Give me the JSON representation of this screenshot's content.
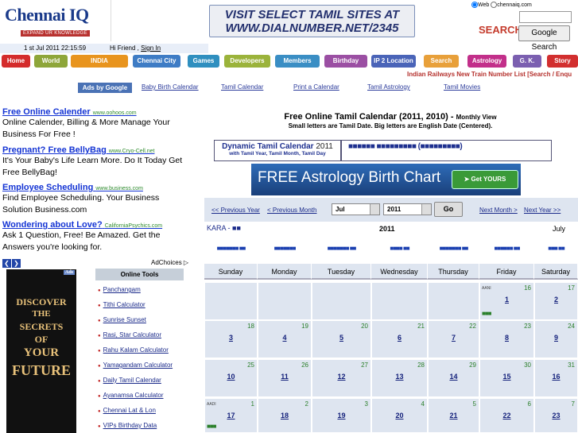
{
  "header": {
    "logo_name": "Chennai IQ",
    "logo_tag": "EXPAND UR KNOWLEDGE",
    "banner_line1": "VISIT SELECT TAMIL SITES AT",
    "banner_line2": "WWW.DIALNUMBER.NET/2345",
    "search": {
      "radio_web": "Web",
      "radio_site": "chennaiq.com",
      "logo_text": "SEARCH",
      "button_label": "Google Search"
    }
  },
  "datebar": {
    "date": "1 st Jul 2011 22:15:59",
    "greeting": "Hi Friend ,",
    "sign_in": "Sign In"
  },
  "nav": [
    {
      "label": "Home",
      "color": "#d42c2c"
    },
    {
      "label": "World",
      "color": "#8ea63a"
    },
    {
      "label": "INDIA",
      "color": "#e8941e"
    },
    {
      "label": "Chennai City",
      "color": "#3e7cc5"
    },
    {
      "label": "Games",
      "color": "#2f8fbf"
    },
    {
      "label": "Developers",
      "color": "#9bb33b"
    },
    {
      "label": "Members",
      "color": "#3a8ec4"
    },
    {
      "label": "Birthday",
      "color": "#9b4fa3"
    },
    {
      "label": "IP 2 Location",
      "color": "#4a64b8"
    },
    {
      "label": "Search",
      "color": "#e8a03a"
    },
    {
      "label": "Astrology",
      "color": "#c22f8a"
    },
    {
      "label": "G. K.",
      "color": "#7b5fb0"
    },
    {
      "label": "Story",
      "color": "#d22f2f"
    }
  ],
  "ticker": "Indian Railways New Train Number List [Search / Enqu",
  "top_links": {
    "ads_by": "Ads by Google",
    "items": [
      "Baby Birth Calendar",
      "Tamil Calendar",
      "Print a Calendar",
      "Tamil Astrology",
      "Tamil Movies"
    ]
  },
  "ads": [
    {
      "title": "Free Online Calender",
      "url": "www.oohoos.com",
      "body": "Online Calender, Billing & More Manage Your Business For Free !"
    },
    {
      "title": "Pregnant? Free BellyBag",
      "url": "www.Cryo-Cell.net",
      "body": "It's Your Baby's Life Learn More. Do It Today Get Free BellyBag!"
    },
    {
      "title": "Employee Scheduling",
      "url": "www.business.com",
      "body": "Find Employee Scheduling. Your Business Solution Business.com"
    },
    {
      "title": "Wondering about Love?",
      "url": "CaliforniaPsychics.com",
      "body": "Ask 1 Question, Free! Be Amazed. Get the Answers you're looking for."
    }
  ],
  "adchoices": "AdChoices",
  "future_ad": {
    "badge": "Ads",
    "lines": [
      "DISCOVER",
      "THE",
      "SECRETS",
      "OF",
      "YOUR",
      "FUTURE"
    ]
  },
  "tools": {
    "heading": "Online Tools",
    "items": [
      "Panchangam",
      "Tithi Calculator",
      "Sunrise Sunset",
      "Rasi, Star Calculator",
      "Rahu Kalam Calculator",
      "Yamagandam Calculator",
      "Daily Tamil Calendar",
      "Ayanamsa Calculator",
      "Chennai Lat & Lon",
      "VIPs Birthday Data"
    ]
  },
  "calendar_title": {
    "title": "Free Online Tamil Calendar (2011, 2010) -",
    "title_small": "Monthly View",
    "subtitle": "Small letters are Tamil Date. Big letters are English Date (Centered)."
  },
  "dynamic": {
    "title": "Dynamic Tamil Calendar",
    "year": "2011",
    "sub": "with Tamil Year, Tamil Month, Tamil Day",
    "tamil_text": "■■■■■■ ■■■■■■■■■ (■■■■■■■■■)"
  },
  "astro_ad": {
    "text": "FREE Astrology Birth Chart",
    "button": "Get YOURS"
  },
  "cal_nav": {
    "prev_year": "<< Previous Year",
    "prev_month": "< Previous Month",
    "month": "Jul",
    "year": "2011",
    "go": "Go",
    "next_month": "Next Month >",
    "next_year": "Next Year >>"
  },
  "cal": {
    "kara": "KARA - ■■",
    "year": "2011",
    "month": "July",
    "tamil_days": [
      "■■■■■■■ ■■",
      "■■■■■■■",
      "■■■■■■■ ■■",
      "■■■■ ■■",
      "■■■■■■■ ■■",
      "■■■■■■ ■■",
      "■■■ ■■"
    ],
    "days": [
      "Sunday",
      "Monday",
      "Tuesday",
      "Wednesday",
      "Thursday",
      "Friday",
      "Saturday"
    ],
    "weeks": [
      [
        null,
        null,
        null,
        null,
        null,
        {
          "tn": "16",
          "en": "1",
          "mo": "AANI",
          "dots": "■■■"
        },
        {
          "tn": "17",
          "en": "2"
        }
      ],
      [
        {
          "tn": "18",
          "en": "3"
        },
        {
          "tn": "19",
          "en": "4"
        },
        {
          "tn": "20",
          "en": "5"
        },
        {
          "tn": "21",
          "en": "6"
        },
        {
          "tn": "22",
          "en": "7"
        },
        {
          "tn": "23",
          "en": "8"
        },
        {
          "tn": "24",
          "en": "9"
        }
      ],
      [
        {
          "tn": "25",
          "en": "10"
        },
        {
          "tn": "26",
          "en": "11"
        },
        {
          "tn": "27",
          "en": "12"
        },
        {
          "tn": "28",
          "en": "13"
        },
        {
          "tn": "29",
          "en": "14"
        },
        {
          "tn": "30",
          "en": "15"
        },
        {
          "tn": "31",
          "en": "16"
        }
      ],
      [
        {
          "tn": "1",
          "en": "17",
          "mo": "AADI",
          "dots": "■■■"
        },
        {
          "tn": "2",
          "en": "18"
        },
        {
          "tn": "3",
          "en": "19"
        },
        {
          "tn": "4",
          "en": "20"
        },
        {
          "tn": "5",
          "en": "21"
        },
        {
          "tn": "6",
          "en": "22"
        },
        {
          "tn": "7",
          "en": "23"
        }
      ]
    ]
  }
}
